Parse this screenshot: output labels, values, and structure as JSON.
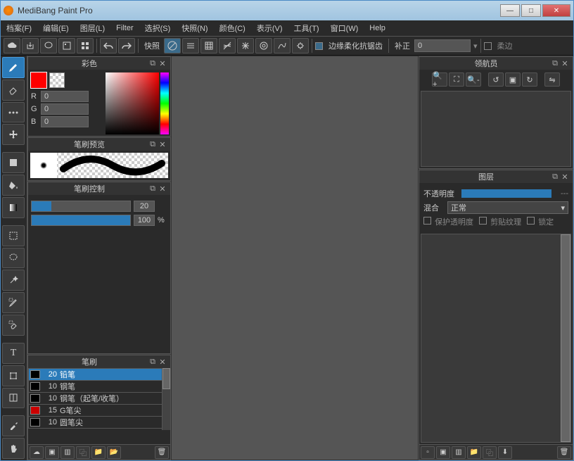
{
  "app_title": "MediBang Paint Pro",
  "menu": [
    "档案(F)",
    "编辑(E)",
    "图层(L)",
    "Filter",
    "选択(S)",
    "快照(N)",
    "颜色(C)",
    "表示(V)",
    "工具(T)",
    "窗口(W)",
    "Help"
  ],
  "toolbar": {
    "snap_label": "快照",
    "aa_label": "边缘柔化抗锯齿",
    "aa_checked": true,
    "correct_label": "补正",
    "correct_value": "0",
    "soft_checked": false,
    "soft_label": "柔边"
  },
  "panels": {
    "color": {
      "title": "彩色",
      "r_label": "R",
      "r_value": "0",
      "g_label": "G",
      "g_value": "0",
      "b_label": "B",
      "b_value": "0"
    },
    "brush_preview": {
      "title": "笔刷预览"
    },
    "brush_control": {
      "title": "笔刷控制",
      "size_value": "20",
      "opacity_value": "100",
      "opacity_unit": "%"
    },
    "brush_list": {
      "title": "笔刷",
      "items": [
        {
          "size": "20",
          "name": "铅笔",
          "color": "#000",
          "selected": true
        },
        {
          "size": "10",
          "name": "钢笔",
          "color": "#000",
          "selected": false
        },
        {
          "size": "10",
          "name": "钢笔（起笔/收笔）",
          "color": "#000",
          "selected": false
        },
        {
          "size": "15",
          "name": "G笔尖",
          "color": "#c00",
          "selected": false
        },
        {
          "size": "10",
          "name": "圆笔尖",
          "color": "#000",
          "selected": false
        }
      ]
    },
    "navigator": {
      "title": "领航员"
    },
    "layers": {
      "title": "图层",
      "opacity_label": "不透明度",
      "opacity_value": "---",
      "blend_label": "混合",
      "blend_value": "正常",
      "protect_label": "保护透明度",
      "clip_label": "剪贴纹理",
      "lock_label": "锁定"
    }
  }
}
